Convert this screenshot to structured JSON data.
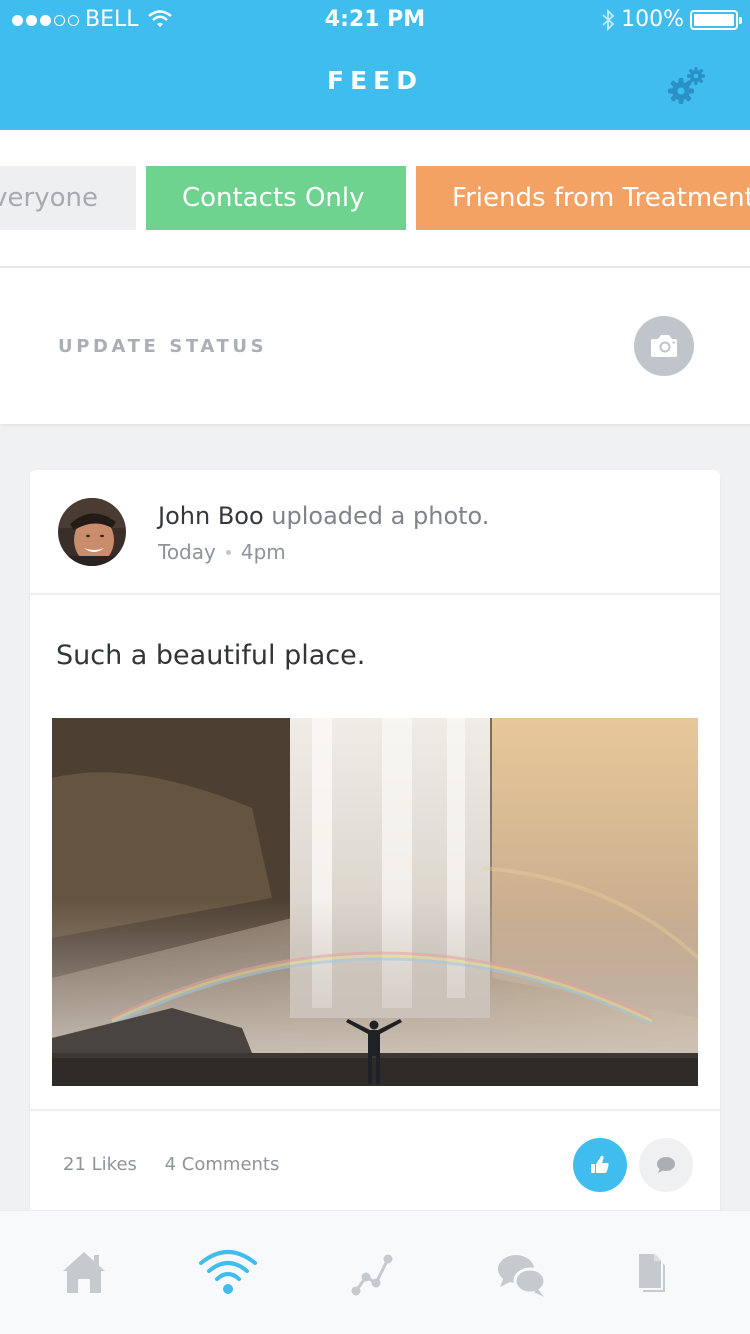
{
  "status_bar": {
    "carrier": "BELL",
    "time": "4:21 PM",
    "battery": "100%",
    "signal_bars_filled": 3,
    "signal_bars_total": 5
  },
  "header": {
    "title": "FEED",
    "settings_icon": "gears-icon",
    "background_color": "#3fbdee"
  },
  "filters": [
    {
      "label": "Everyone",
      "color": "#eeeff1"
    },
    {
      "label": "Contacts Only",
      "color": "#6ed38f"
    },
    {
      "label": "Friends from Treatment",
      "color": "#f4a164"
    }
  ],
  "update_status": {
    "label": "UPDATE STATUS",
    "camera_icon": "camera-icon"
  },
  "post": {
    "author": "John Boo",
    "action": "uploaded a photo.",
    "day": "Today",
    "time": "4pm",
    "text": "Such a beautiful place.",
    "likes": "21 Likes",
    "comments": "4 Comments",
    "like_icon": "thumbs-up-icon",
    "comment_icon": "comment-icon"
  },
  "tabbar": {
    "items": [
      {
        "icon": "home-icon",
        "active": false
      },
      {
        "icon": "feed-wifi-icon",
        "active": true
      },
      {
        "icon": "progress-chart-icon",
        "active": false
      },
      {
        "icon": "chat-bubbles-icon",
        "active": false
      },
      {
        "icon": "documents-icon",
        "active": false
      }
    ],
    "active_color": "#3fbdee",
    "inactive_color": "#c5cacf"
  }
}
